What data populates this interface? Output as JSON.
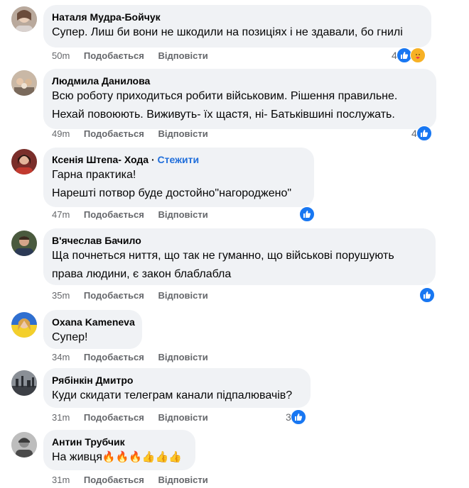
{
  "comments": [
    {
      "author": "Наталя Мудра-Бойчук",
      "lines": [
        "Супер. Лиш би вони не шкодили на позиціях і не здавали, бо гнилі"
      ],
      "time": "50m",
      "like": "Подобається",
      "reply": "Відповісти",
      "reaction_count": "4",
      "reaction_icons": [
        "like-icon",
        "care-icon"
      ]
    },
    {
      "author": "Людмила Данилова",
      "lines": [
        "Всю роботу приходиться робити військовим. Рішення правильне.",
        "Нехай повоюють. Виживуть- їх щастя, ні- Батьківшині послужать."
      ],
      "time": "49m",
      "like": "Подобається",
      "reply": "Відповісти",
      "reaction_count": "4",
      "reaction_icons": [
        "like-icon"
      ]
    },
    {
      "author": "Ксенія Штепа- Хода",
      "follow": "Стежити",
      "lines": [
        "Гарна практика!",
        "Нарешті потвор буде достойно\"нагороджено\""
      ],
      "time": "47m",
      "like": "Подобається",
      "reply": "Відповісти",
      "reaction_count": "",
      "reaction_icons": [
        "like-icon"
      ]
    },
    {
      "author": "В'ячеслав Бачило",
      "lines": [
        "Ща почнеться ниття, що так не гуманно, що військові порушують",
        "права людини, є закон блаблабла"
      ],
      "time": "35m",
      "like": "Подобається",
      "reply": "Відповісти",
      "reaction_count": "",
      "reaction_icons": [
        "like-icon"
      ]
    },
    {
      "author": "Oxana Kameneva",
      "lines": [
        "Супер!"
      ],
      "time": "34m",
      "like": "Подобається",
      "reply": "Відповісти",
      "reaction_count": "",
      "reaction_icons": []
    },
    {
      "author": "Рябінкін Дмитро",
      "lines": [
        "Куди скидати телеграм канали підпалювачів?"
      ],
      "time": "31m",
      "like": "Подобається",
      "reply": "Відповісти",
      "reaction_count": "3",
      "reaction_icons": [
        "like-icon"
      ]
    },
    {
      "author": "Антин Трубчик",
      "text_prefix": "На живця",
      "emojis": "🔥🔥🔥👍👍👍",
      "time": "31m",
      "like": "Подобається",
      "reply": "Відповісти",
      "reaction_count": "",
      "reaction_icons": []
    }
  ],
  "colors": {
    "bubble": "#f0f2f5",
    "like": "#1877f2",
    "link": "#216fdb",
    "meta": "#65676b"
  }
}
